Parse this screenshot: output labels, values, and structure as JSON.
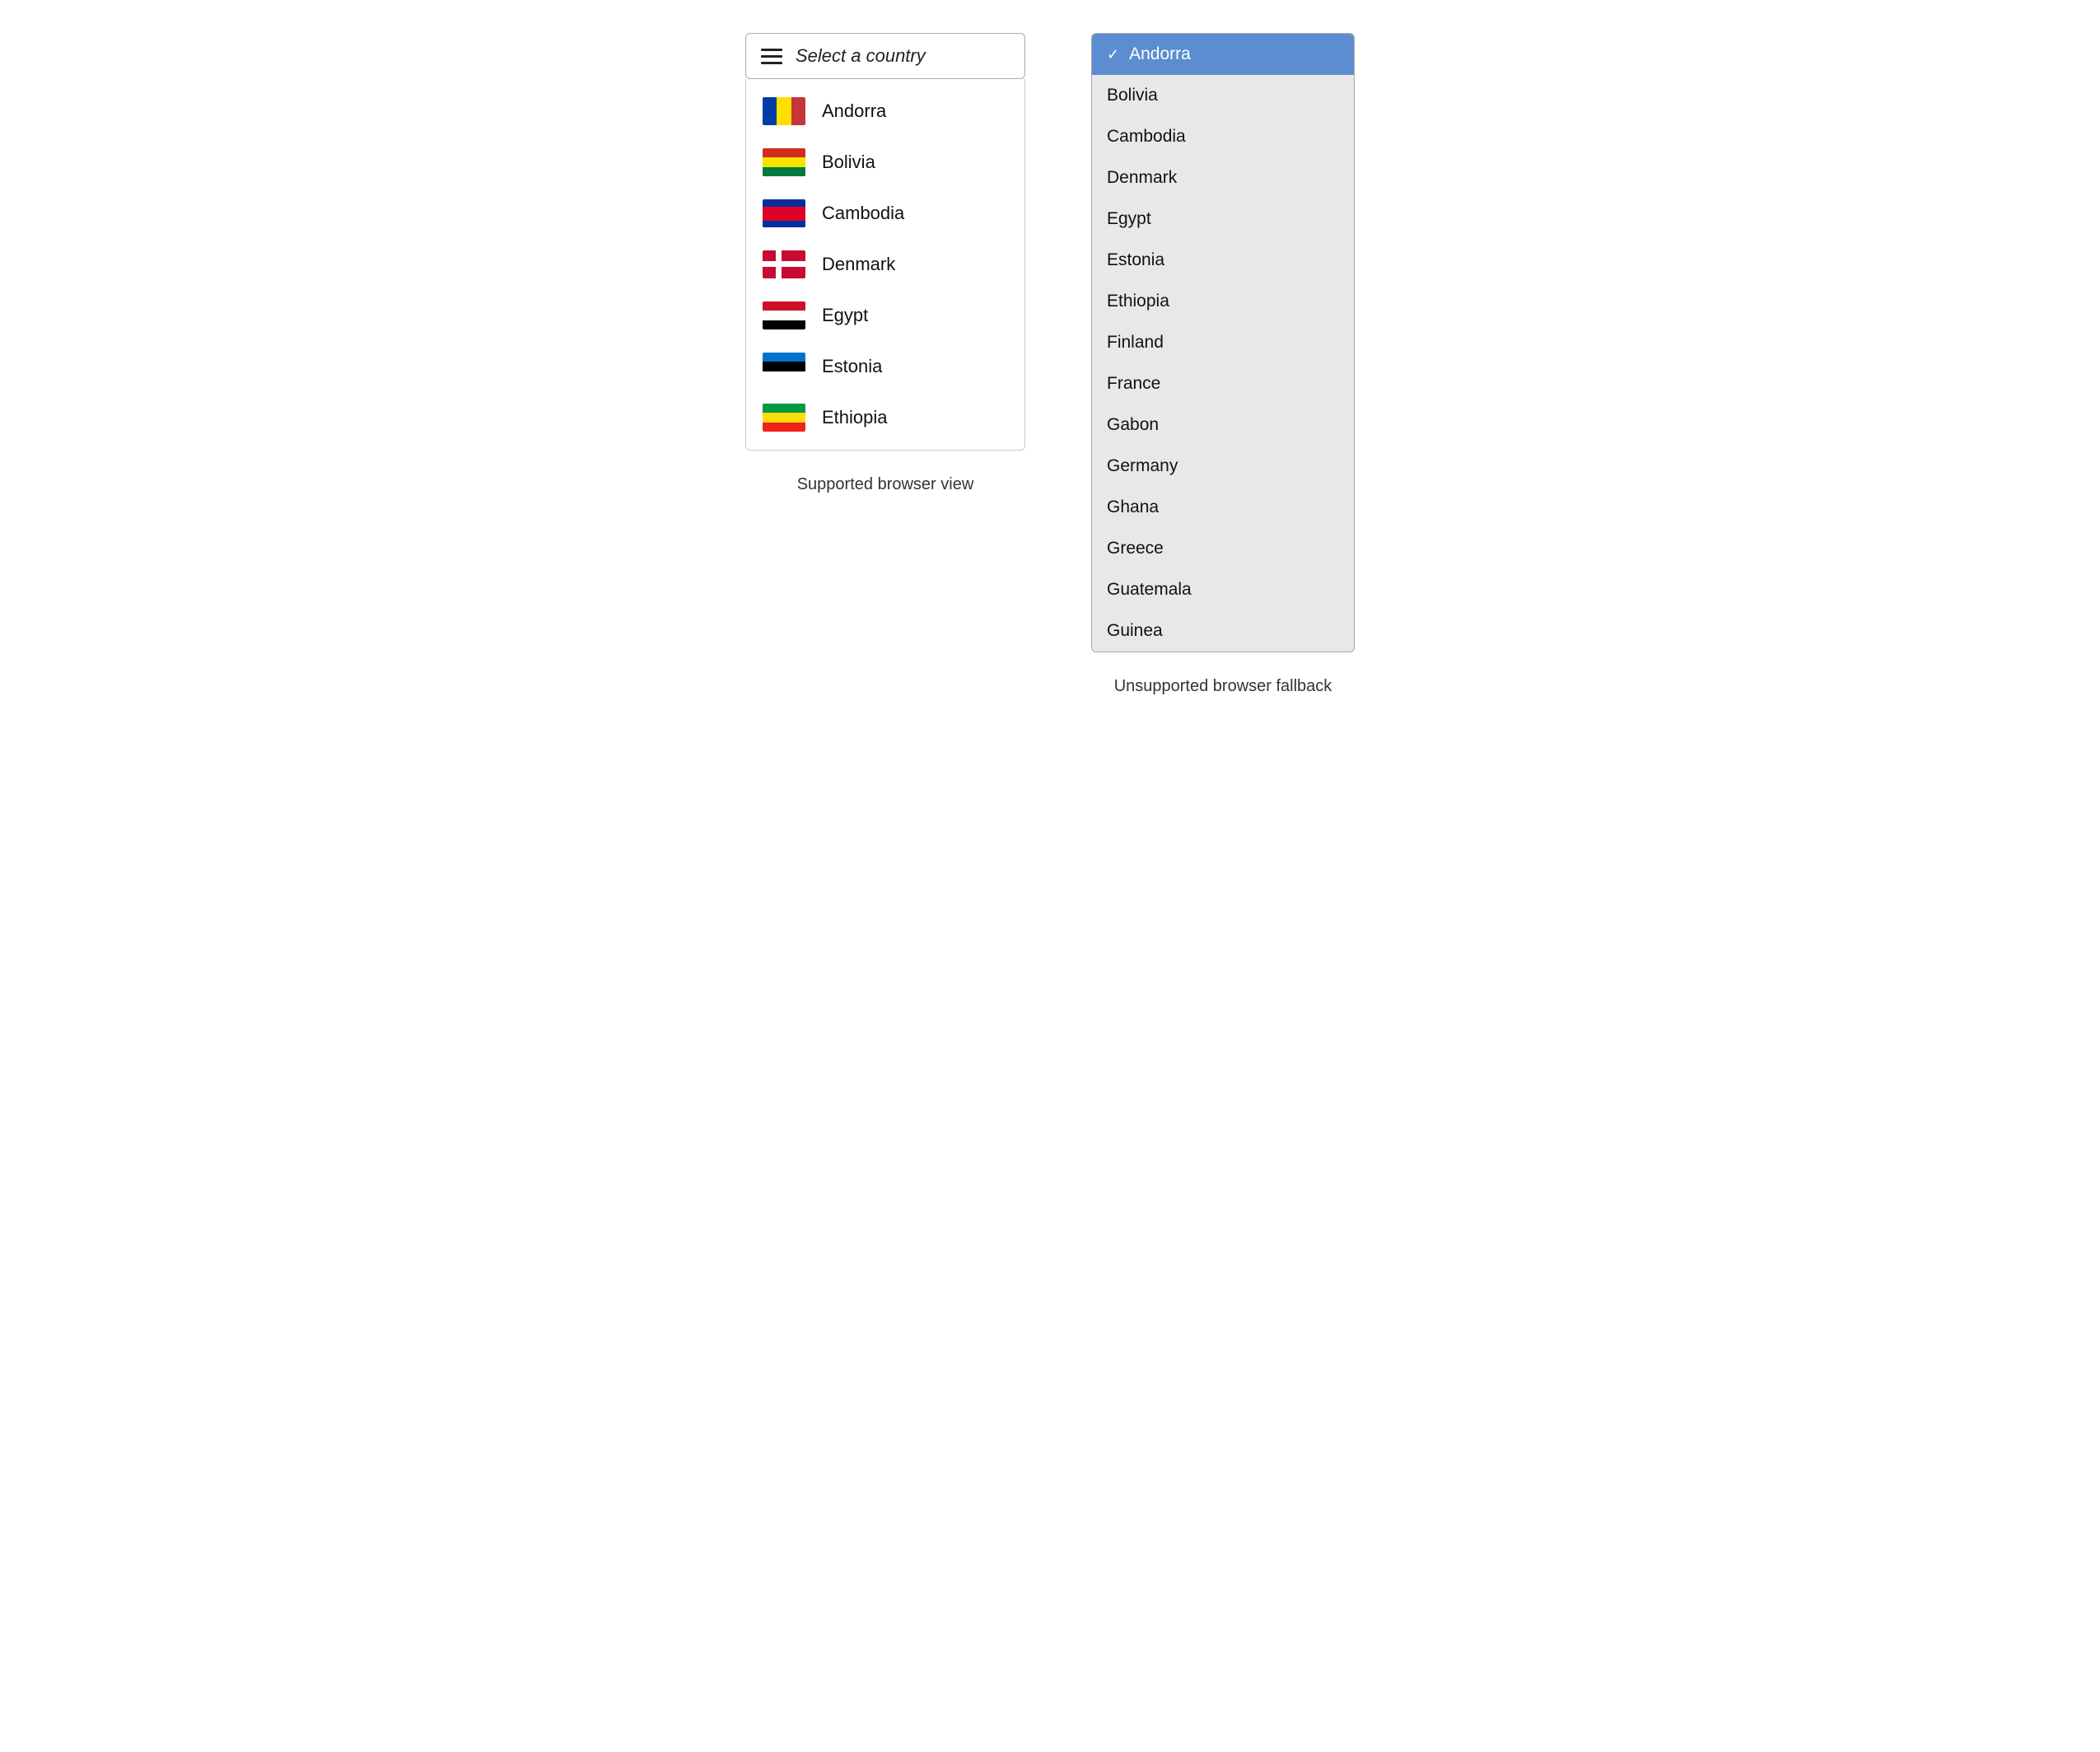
{
  "left": {
    "trigger": {
      "placeholder": "Select a country",
      "icon": "hamburger-icon"
    },
    "items": [
      {
        "name": "Andorra",
        "flag": "andorra"
      },
      {
        "name": "Bolivia",
        "flag": "bolivia"
      },
      {
        "name": "Cambodia",
        "flag": "cambodia"
      },
      {
        "name": "Denmark",
        "flag": "denmark"
      },
      {
        "name": "Egypt",
        "flag": "egypt"
      },
      {
        "name": "Estonia",
        "flag": "estonia"
      },
      {
        "name": "Ethiopia",
        "flag": "ethiopia"
      }
    ],
    "label": "Supported browser view"
  },
  "right": {
    "items": [
      {
        "name": "Andorra",
        "selected": true
      },
      {
        "name": "Bolivia",
        "selected": false
      },
      {
        "name": "Cambodia",
        "selected": false
      },
      {
        "name": "Denmark",
        "selected": false
      },
      {
        "name": "Egypt",
        "selected": false
      },
      {
        "name": "Estonia",
        "selected": false
      },
      {
        "name": "Ethiopia",
        "selected": false
      },
      {
        "name": "Finland",
        "selected": false
      },
      {
        "name": "France",
        "selected": false
      },
      {
        "name": "Gabon",
        "selected": false
      },
      {
        "name": "Germany",
        "selected": false
      },
      {
        "name": "Ghana",
        "selected": false
      },
      {
        "name": "Greece",
        "selected": false
      },
      {
        "name": "Guatemala",
        "selected": false
      },
      {
        "name": "Guinea",
        "selected": false
      }
    ],
    "label": "Unsupported browser fallback"
  }
}
